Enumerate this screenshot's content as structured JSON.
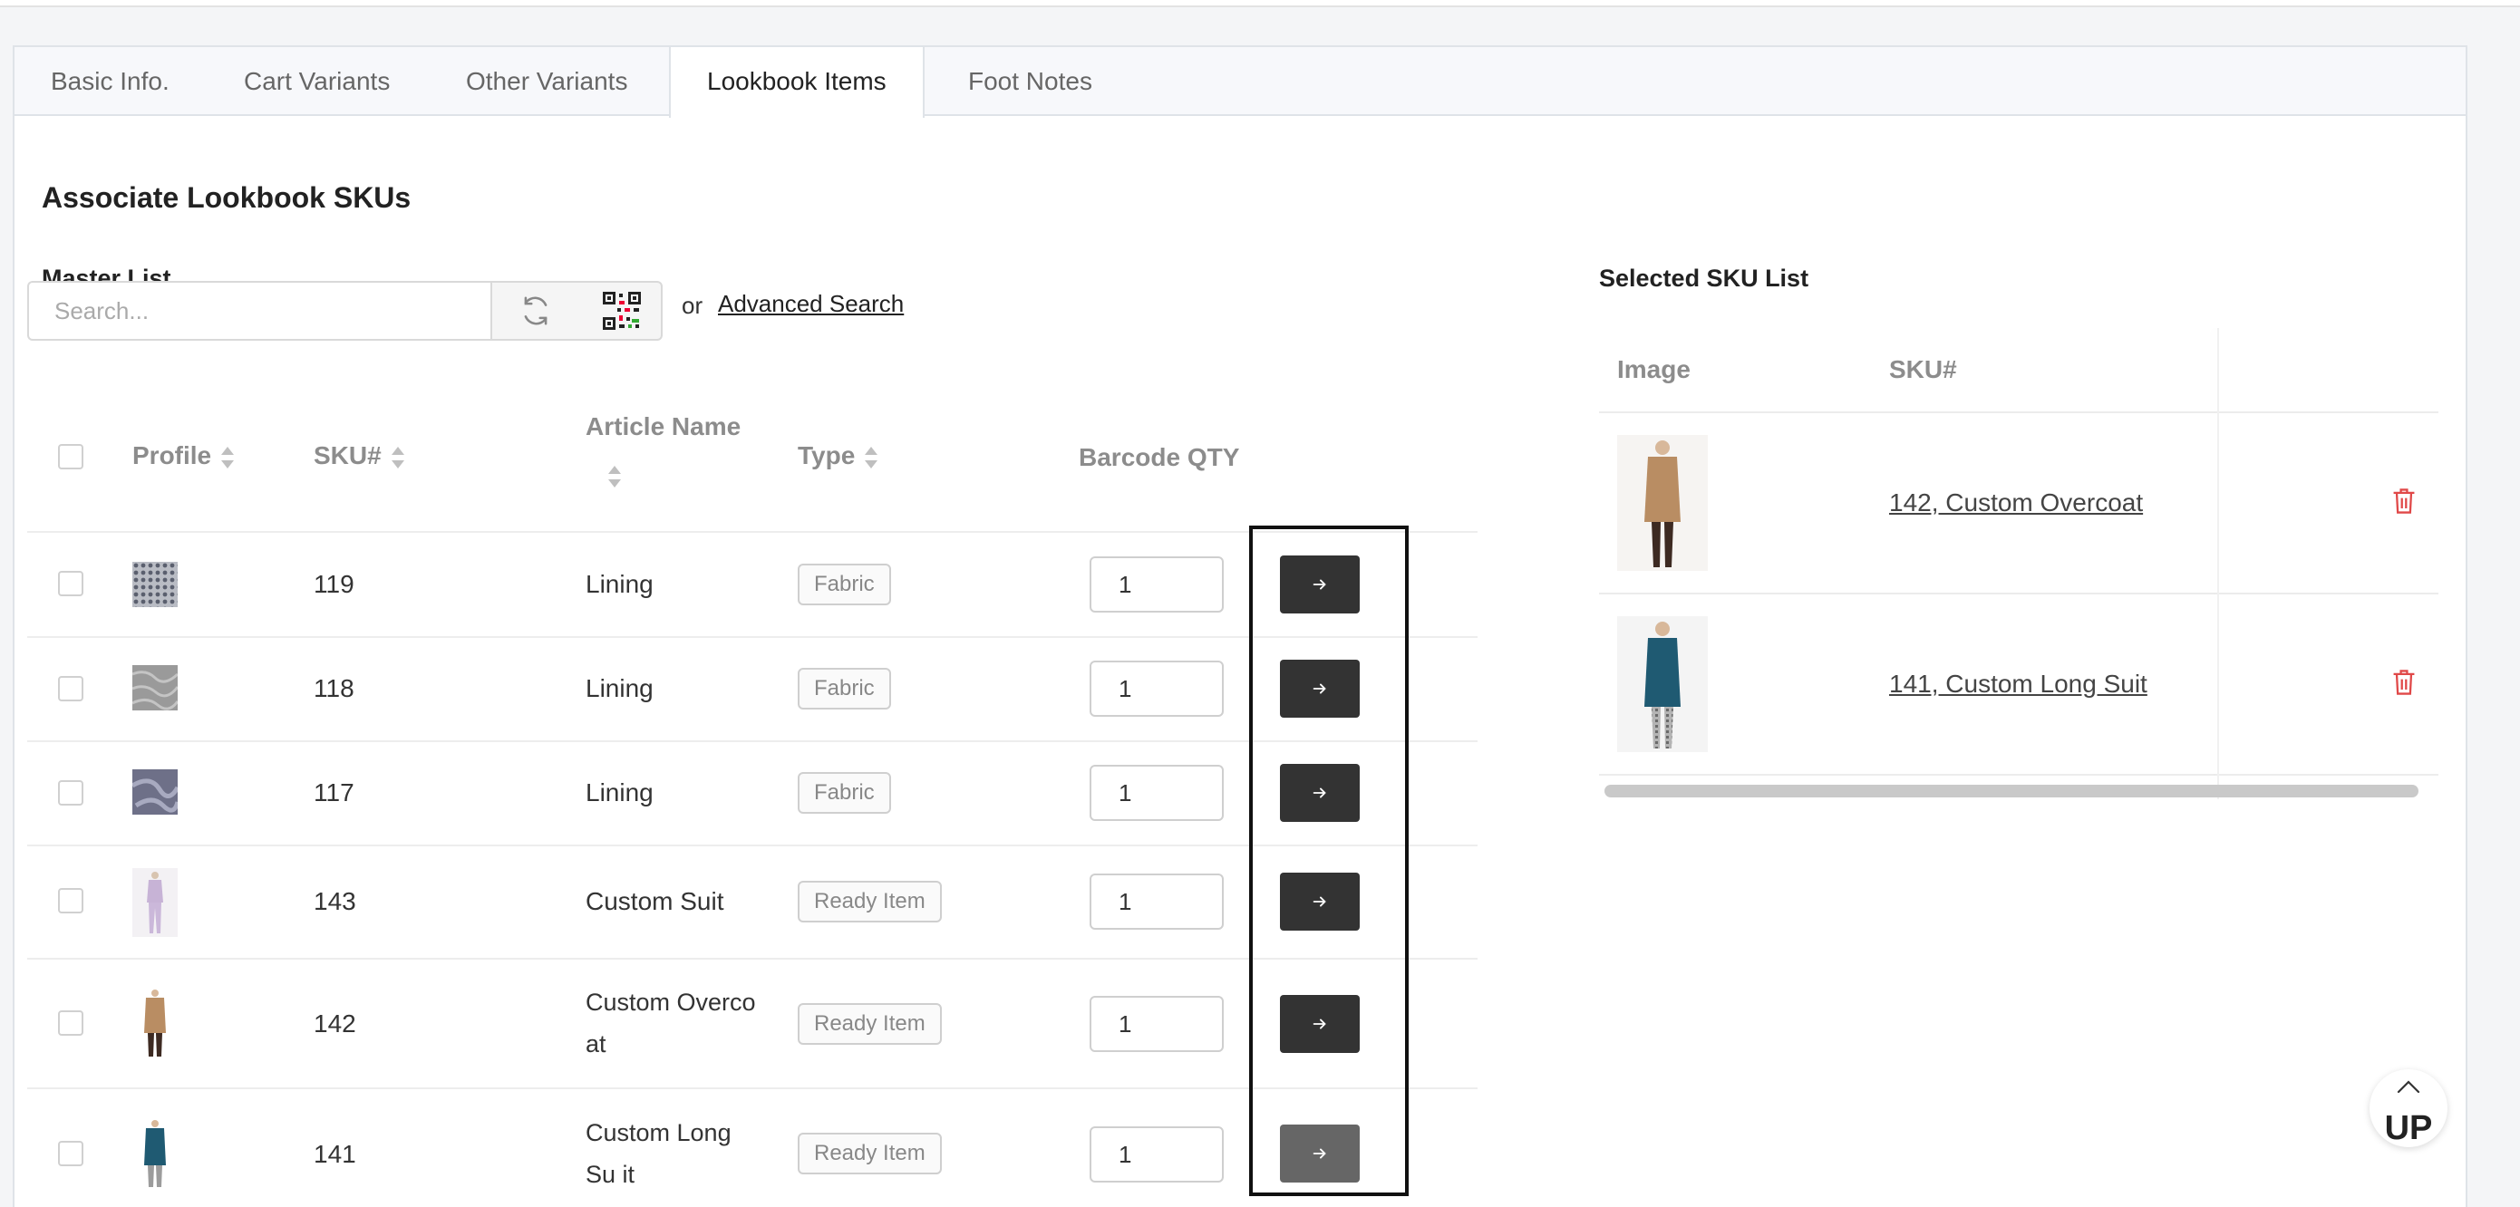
{
  "tabs": [
    {
      "label": "Basic Info."
    },
    {
      "label": "Cart Variants"
    },
    {
      "label": "Other Variants"
    },
    {
      "label": "Lookbook Items"
    },
    {
      "label": "Foot Notes"
    }
  ],
  "active_tab": "Lookbook Items",
  "section_title": "Associate Lookbook SKUs",
  "master_list": {
    "title": "Master List",
    "search_placeholder": "Search...",
    "or_text": "or",
    "advanced_search": "Advanced Search",
    "columns": {
      "profile": "Profile",
      "sku": "SKU#",
      "article_name": "Article Name",
      "type": "Type",
      "barcode_qty": "Barcode QTY"
    },
    "rows": [
      {
        "sku": "119",
        "name": "Lining",
        "type": "Fabric",
        "qty": "1",
        "thumb": "fabric-pattern"
      },
      {
        "sku": "118",
        "name": "Lining",
        "type": "Fabric",
        "qty": "1",
        "thumb": "fabric-grey"
      },
      {
        "sku": "117",
        "name": "Lining",
        "type": "Fabric",
        "qty": "1",
        "thumb": "fabric-silk"
      },
      {
        "sku": "143",
        "name": "Custom Suit",
        "type": "Ready Item",
        "qty": "1",
        "thumb": "suit-lilac"
      },
      {
        "sku": "142",
        "name": "Custom Overco at",
        "type": "Ready Item",
        "qty": "1",
        "thumb": "overcoat-camel"
      },
      {
        "sku": "141",
        "name": "Custom Long Su it",
        "type": "Ready Item",
        "qty": "1",
        "thumb": "longsuit-teal"
      }
    ]
  },
  "selected_list": {
    "title": "Selected SKU List",
    "columns": {
      "image": "Image",
      "sku": "SKU#"
    },
    "rows": [
      {
        "sku_label": "142, Custom Overcoat",
        "thumb": "overcoat-camel"
      },
      {
        "sku_label": "141, Custom Long Suit",
        "thumb": "longsuit-teal"
      }
    ]
  },
  "up_button": "UP",
  "colors": {
    "accent_dark": "#333333",
    "delete_red": "#e04848",
    "tab_bg": "#f7f8fb"
  }
}
